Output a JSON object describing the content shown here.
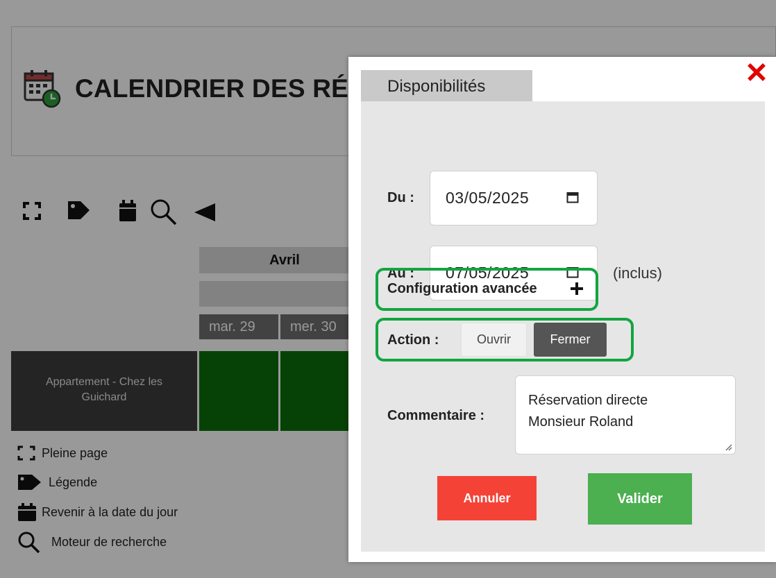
{
  "page": {
    "title": "CALENDRIER DES RÉS",
    "title_icon": "calendar-clock-icon"
  },
  "toolbar": {
    "icons": [
      "fullscreen-icon",
      "tag-icon",
      "calendar-icon",
      "search-icon",
      "arrow-left-icon"
    ]
  },
  "calendar": {
    "month": "Avril",
    "days": [
      "mar. 29",
      "mer. 30"
    ],
    "room": "Appartement - Chez les Guichard",
    "status_color": "#0a6e0a"
  },
  "legend": {
    "items": [
      {
        "icon": "fullscreen-icon",
        "label": "Pleine page"
      },
      {
        "icon": "tag-icon",
        "label": "Légende"
      },
      {
        "icon": "calendar-icon",
        "label": "Revenir à la date du jour"
      },
      {
        "icon": "search-icon",
        "label": "Moteur de recherche"
      }
    ]
  },
  "modal": {
    "tab_label": "Disponibilités",
    "from_label": "Du :",
    "from_value": "03/05/2025",
    "to_label": "Au :",
    "to_value": "07/05/2025",
    "to_suffix": "(inclus)",
    "advanced_label": "Configuration avancée",
    "action_label": "Action :",
    "open_label": "Ouvrir",
    "close_label": "Fermer",
    "comment_label": "Commentaire :",
    "comment_line1": "Réservation directe",
    "comment_line2": "Monsieur Roland",
    "cancel_label": "Annuler",
    "validate_label": "Valider"
  },
  "colors": {
    "highlight": "#12a541",
    "cancel": "#f44336",
    "validate": "#4caf50",
    "close_x": "#e00000",
    "selected_action": "#555555"
  }
}
